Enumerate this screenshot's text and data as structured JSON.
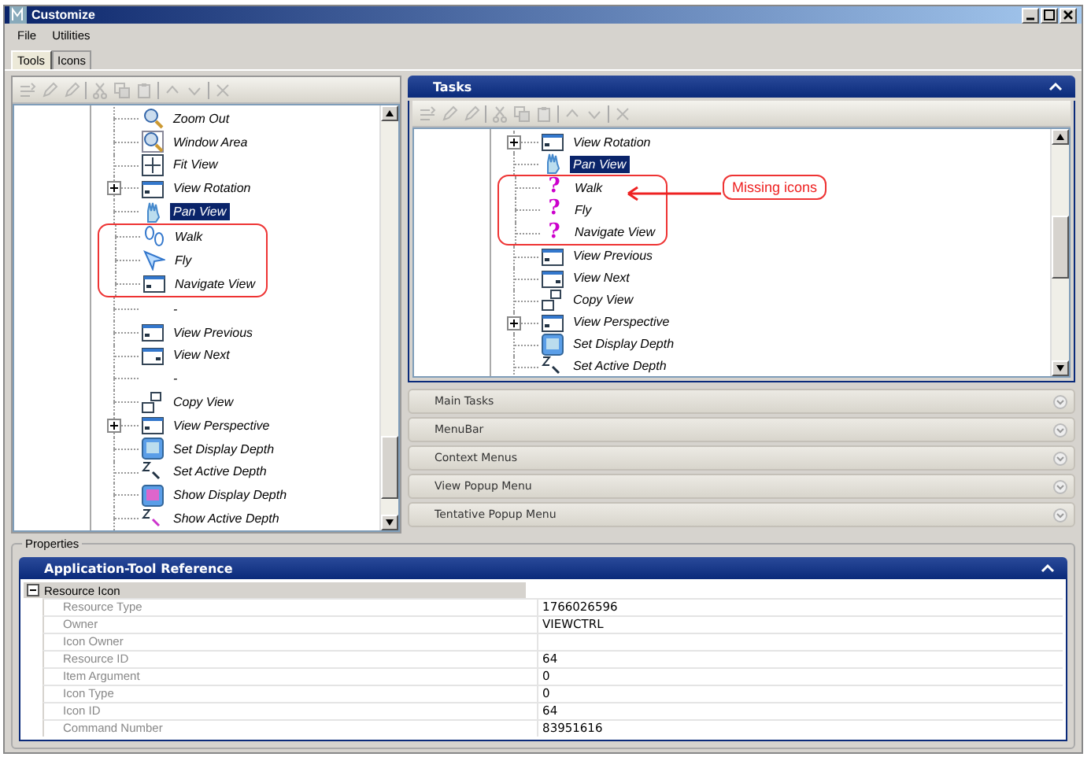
{
  "window": {
    "title": "Customize"
  },
  "menu": [
    "File",
    "Utilities"
  ],
  "tabs": [
    {
      "label": "Tools",
      "selected": true
    },
    {
      "label": "Icons",
      "selected": false
    }
  ],
  "tools_panel": {
    "toolbar_disabled": true,
    "items": [
      {
        "label": "Zoom Out",
        "kind": "magnifier",
        "selected": false,
        "circled": false
      },
      {
        "label": "Window Area",
        "kind": "window-magnifier",
        "selected": false,
        "circled": false
      },
      {
        "label": "Fit View",
        "kind": "fit",
        "selected": false,
        "circled": false
      },
      {
        "label": "View Rotation",
        "kind": "rotation",
        "selected": false,
        "circled": false,
        "expanded": false
      },
      {
        "label": "Pan View",
        "kind": "hand",
        "selected": true,
        "circled": false
      },
      {
        "label": "Walk",
        "kind": "footprints",
        "selected": false,
        "circled": true
      },
      {
        "label": "Fly",
        "kind": "plane",
        "selected": false,
        "circled": true
      },
      {
        "label": "Navigate View",
        "kind": "navigate",
        "selected": false,
        "circled": true
      },
      {
        "label": "-",
        "kind": "none",
        "selected": false,
        "circled": false
      },
      {
        "label": "View Previous",
        "kind": "view-prev",
        "selected": false,
        "circled": false
      },
      {
        "label": "View Next",
        "kind": "view-next",
        "selected": false,
        "circled": false
      },
      {
        "label": "-",
        "kind": "none",
        "selected": false,
        "circled": false
      },
      {
        "label": "Copy View",
        "kind": "copy",
        "selected": false,
        "circled": false
      },
      {
        "label": "View Perspective",
        "kind": "perspective",
        "selected": false,
        "circled": false,
        "expanded": false
      },
      {
        "label": "Set Display Depth",
        "kind": "screen",
        "selected": false,
        "circled": false
      },
      {
        "label": "Set Active Depth",
        "kind": "z-arrow",
        "selected": false,
        "circled": false
      },
      {
        "label": "Show Display Depth",
        "kind": "screen-question",
        "selected": false,
        "circled": false
      },
      {
        "label": "Show Active Depth",
        "kind": "z-question",
        "selected": false,
        "circled": false
      }
    ]
  },
  "tasks_panel": {
    "title": "Tasks",
    "expanded": true,
    "toolbar_disabled": true,
    "callout": "Missing icons",
    "items": [
      {
        "label": "View Rotation",
        "kind": "perspective",
        "selected": false,
        "circled": false,
        "expanded": false
      },
      {
        "label": "Pan View",
        "kind": "hand",
        "selected": true,
        "circled": false
      },
      {
        "label": "Walk",
        "kind": "missing",
        "glyph": "?",
        "selected": false,
        "circled": true
      },
      {
        "label": "Fly",
        "kind": "missing",
        "glyph": "?",
        "selected": false,
        "circled": true
      },
      {
        "label": "Navigate View",
        "kind": "missing",
        "glyph": "?",
        "selected": false,
        "circled": true
      },
      {
        "label": "View Previous",
        "kind": "view-prev",
        "selected": false,
        "circled": false
      },
      {
        "label": "View Next",
        "kind": "view-next",
        "selected": false,
        "circled": false
      },
      {
        "label": "Copy View",
        "kind": "copy",
        "selected": false,
        "circled": false
      },
      {
        "label": "View Perspective",
        "kind": "perspective",
        "selected": false,
        "circled": false,
        "expanded": false
      },
      {
        "label": "Set Display Depth",
        "kind": "screen",
        "selected": false,
        "circled": false
      },
      {
        "label": "Set Active Depth",
        "kind": "z-arrow",
        "selected": false,
        "circled": false
      }
    ]
  },
  "sections": [
    {
      "label": "Main Tasks",
      "expanded": false
    },
    {
      "label": "MenuBar",
      "expanded": false
    },
    {
      "label": "Context Menus",
      "expanded": false
    },
    {
      "label": "View Popup Menu",
      "expanded": false
    },
    {
      "label": "Tentative Popup Menu",
      "expanded": false
    }
  ],
  "properties": {
    "group_label": "Properties",
    "title": "Application-Tool Reference",
    "expanded": true,
    "category": {
      "label": "Resource Icon",
      "expanded": true
    },
    "rows": [
      {
        "name": "Resource Type",
        "value": "1766026596"
      },
      {
        "name": "Owner",
        "value": "VIEWCTRL"
      },
      {
        "name": "Icon Owner",
        "value": ""
      },
      {
        "name": "Resource ID",
        "value": "64"
      },
      {
        "name": "Item Argument",
        "value": "0"
      },
      {
        "name": "Icon Type",
        "value": "0"
      },
      {
        "name": "Icon ID",
        "value": "64"
      },
      {
        "name": "Command Number",
        "value": "83951616"
      }
    ]
  }
}
